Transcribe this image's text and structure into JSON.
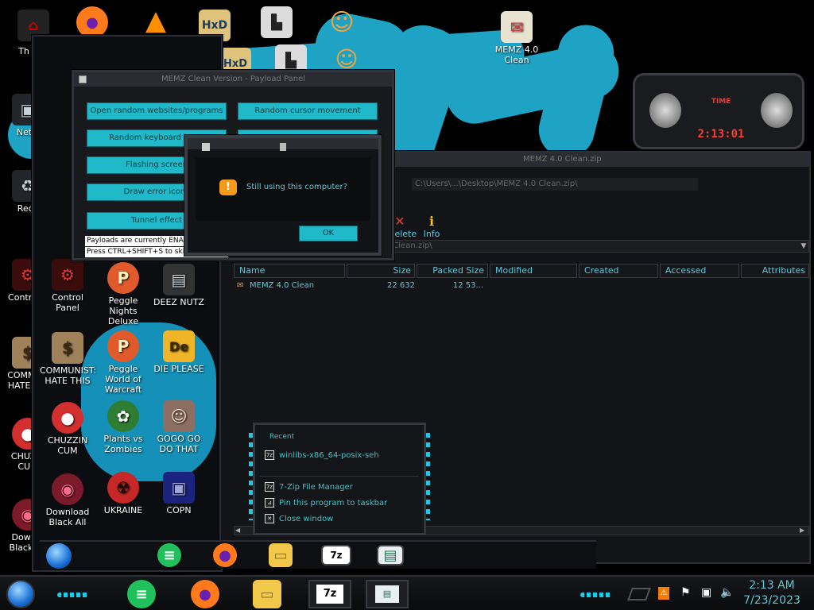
{
  "desktop_icons_left": [
    {
      "label": "Netw",
      "color": "#c8d1d6",
      "glyph": "▣"
    },
    {
      "label": "Recy",
      "color": "#c8d1d6",
      "glyph": "♻"
    },
    {
      "label": "Control P",
      "color": "#c62828",
      "glyph": "⚙"
    },
    {
      "label": "COMMUN HATE THI",
      "color": "#a0825a",
      "glyph": "$"
    },
    {
      "label": "CHUZZI CUM",
      "color": "#d32f2f",
      "glyph": "●"
    },
    {
      "label": "Downlo Black All",
      "color": "#7a1a2a",
      "glyph": "◉"
    }
  ],
  "desktop_icons_inner": [
    {
      "label": "Control Panel",
      "color": "#c62828",
      "glyph": "⚙"
    },
    {
      "label": "Peggle Nights Deluxe",
      "color": "#e05a2b",
      "glyph": "P"
    },
    {
      "label": "DEEZ NUTZ",
      "color": "#cfd8dc",
      "glyph": "▤"
    },
    {
      "label": "COMMUNIST: HATE THIS",
      "color": "#a0825a",
      "glyph": "$"
    },
    {
      "label": "Peggle World of Warcraft",
      "color": "#e05a2b",
      "glyph": "P"
    },
    {
      "label": "DIE PLEASE",
      "color": "#f0b429",
      "glyph": "De"
    },
    {
      "label": "CHUZZIN CUM",
      "color": "#d32f2f",
      "glyph": "●"
    },
    {
      "label": "Plants vs Zombies",
      "color": "#6fbf5b",
      "glyph": "✿"
    },
    {
      "label": "GOGO GO DO THAT",
      "color": "#8d6e63",
      "glyph": "☺"
    },
    {
      "label": "Download Black All",
      "color": "#7a1a2a",
      "glyph": "◉"
    },
    {
      "label": "UKRAINE",
      "color": "#c62828",
      "glyph": "☢"
    },
    {
      "label": "COPN",
      "color": "#3949ab",
      "glyph": "▣"
    }
  ],
  "top_icons": [
    {
      "label": "Th",
      "color": "#333"
    },
    {
      "label": "",
      "color": "#ff7a1a"
    },
    {
      "label": "",
      "color": "#ff8f00"
    },
    {
      "label": "HxD",
      "color": "#e0c37a"
    },
    {
      "label": "",
      "color": "#dcdcdc"
    },
    {
      "label": "",
      "color": "#f4a340"
    }
  ],
  "menz_desktop_label": "MEMZ 4.0 Clean",
  "payload_window": {
    "title": "MEMZ Clean Version - Payload Panel",
    "buttons": [
      "Open random websites/programs",
      "Random cursor movement",
      "Random keyboard input",
      "",
      "Flashing screen",
      "",
      "Draw error icons",
      "",
      "Tunnel effect",
      ""
    ],
    "status_line": "Payloads are currently ENABLED",
    "hint_line": "Press CTRL+SHIFT+S to skip"
  },
  "dialog": {
    "message": "Still using this computer?",
    "ok_label": "OK"
  },
  "sevenzip_window": {
    "title": "MEMZ 4.0 Clean.zip",
    "path_title": "C:\\Users\\...\\Desktop\\MEMZ 4.0 Clean.zip\\",
    "toolbar": {
      "delete_label": "Delete",
      "info_label": "Info"
    },
    "columns": [
      "Name",
      "Size",
      "Packed Size",
      "Modified",
      "Created",
      "Accessed",
      "Attributes"
    ],
    "rows": [
      {
        "name": "MEMZ 4.0 Clean",
        "size": "22 632",
        "packed": "12 53..."
      }
    ]
  },
  "jump_list": {
    "recent_header": "Recent",
    "recent_items": [
      "winlibs-x86_64-posix-seh"
    ],
    "tasks": [
      "7-Zip File Manager",
      "Pin this program to taskbar",
      "Close window"
    ]
  },
  "clock_widget": {
    "label": "TIME",
    "time": "2:13:01"
  },
  "taskbar": {
    "pinned": [
      "start-orb",
      "notes",
      "firefox",
      "explorer",
      "7zip",
      "window"
    ],
    "time": "2:13 AM",
    "date": "7/23/2023",
    "tray": [
      "notification-icon",
      "flag-icon",
      "network-icon",
      "volume-icon"
    ]
  },
  "colors": {
    "accent": "#1fb9c9",
    "bg": "#000000",
    "frame": "#1a1c20"
  }
}
